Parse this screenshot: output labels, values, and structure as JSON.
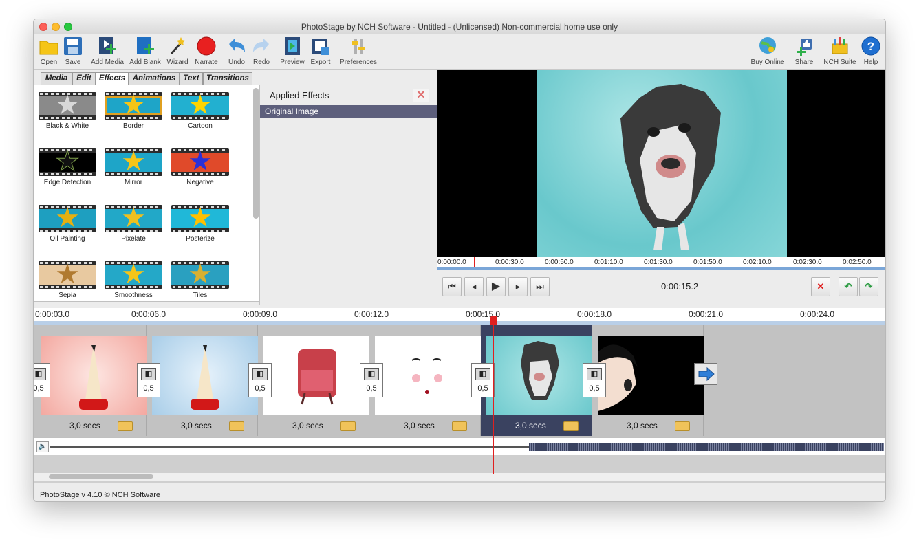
{
  "window": {
    "title": "PhotoStage by NCH Software - Untitled - (Unlicensed) Non-commercial home use only"
  },
  "toolbar": {
    "left": [
      "Open",
      "Save",
      "Add Media",
      "Add Blank",
      "Wizard",
      "Narrate",
      "Undo",
      "Redo",
      "Preview",
      "Export",
      "Preferences"
    ],
    "right": [
      "Buy Online",
      "Share",
      "NCH Suite",
      "Help"
    ]
  },
  "tabs": [
    "Media",
    "Edit",
    "Effects",
    "Animations",
    "Text",
    "Transitions"
  ],
  "active_tab": "Effects",
  "effects": [
    "Black & White",
    "Border",
    "Cartoon",
    "Edge Detection",
    "Mirror",
    "Negative",
    "Oil Painting",
    "Pixelate",
    "Posterize",
    "Sepia",
    "Smoothness",
    "Tiles"
  ],
  "applied_effects": {
    "title": "Applied Effects",
    "items": [
      "Original Image"
    ]
  },
  "preview_ruler": [
    "0:00:00.0",
    "0:00:30.0",
    "0:00:50.0",
    "0:01:10.0",
    "0:01:30.0",
    "0:01:50.0",
    "0:02:10.0",
    "0:02:30.0",
    "0:02:50.0"
  ],
  "playback": {
    "time": "0:00:15.2"
  },
  "timeline_ruler": [
    "0:00:03.0",
    "0:00:06.0",
    "0:00:09.0",
    "0:00:12.0",
    "0:00:15.0",
    "0:00:18.0",
    "0:00:21.0",
    "0:00:24.0"
  ],
  "clips": [
    {
      "duration": "3,0 secs",
      "transition": "0,5"
    },
    {
      "duration": "3,0 secs",
      "transition": "0,5"
    },
    {
      "duration": "3,0 secs",
      "transition": "0,5"
    },
    {
      "duration": "3,0 secs",
      "transition": "0,5"
    },
    {
      "duration": "3,0 secs",
      "transition": "0,5"
    },
    {
      "duration": "3,0 secs",
      "transition": "0,5"
    }
  ],
  "status": "PhotoStage v 4.10 © NCH Software"
}
